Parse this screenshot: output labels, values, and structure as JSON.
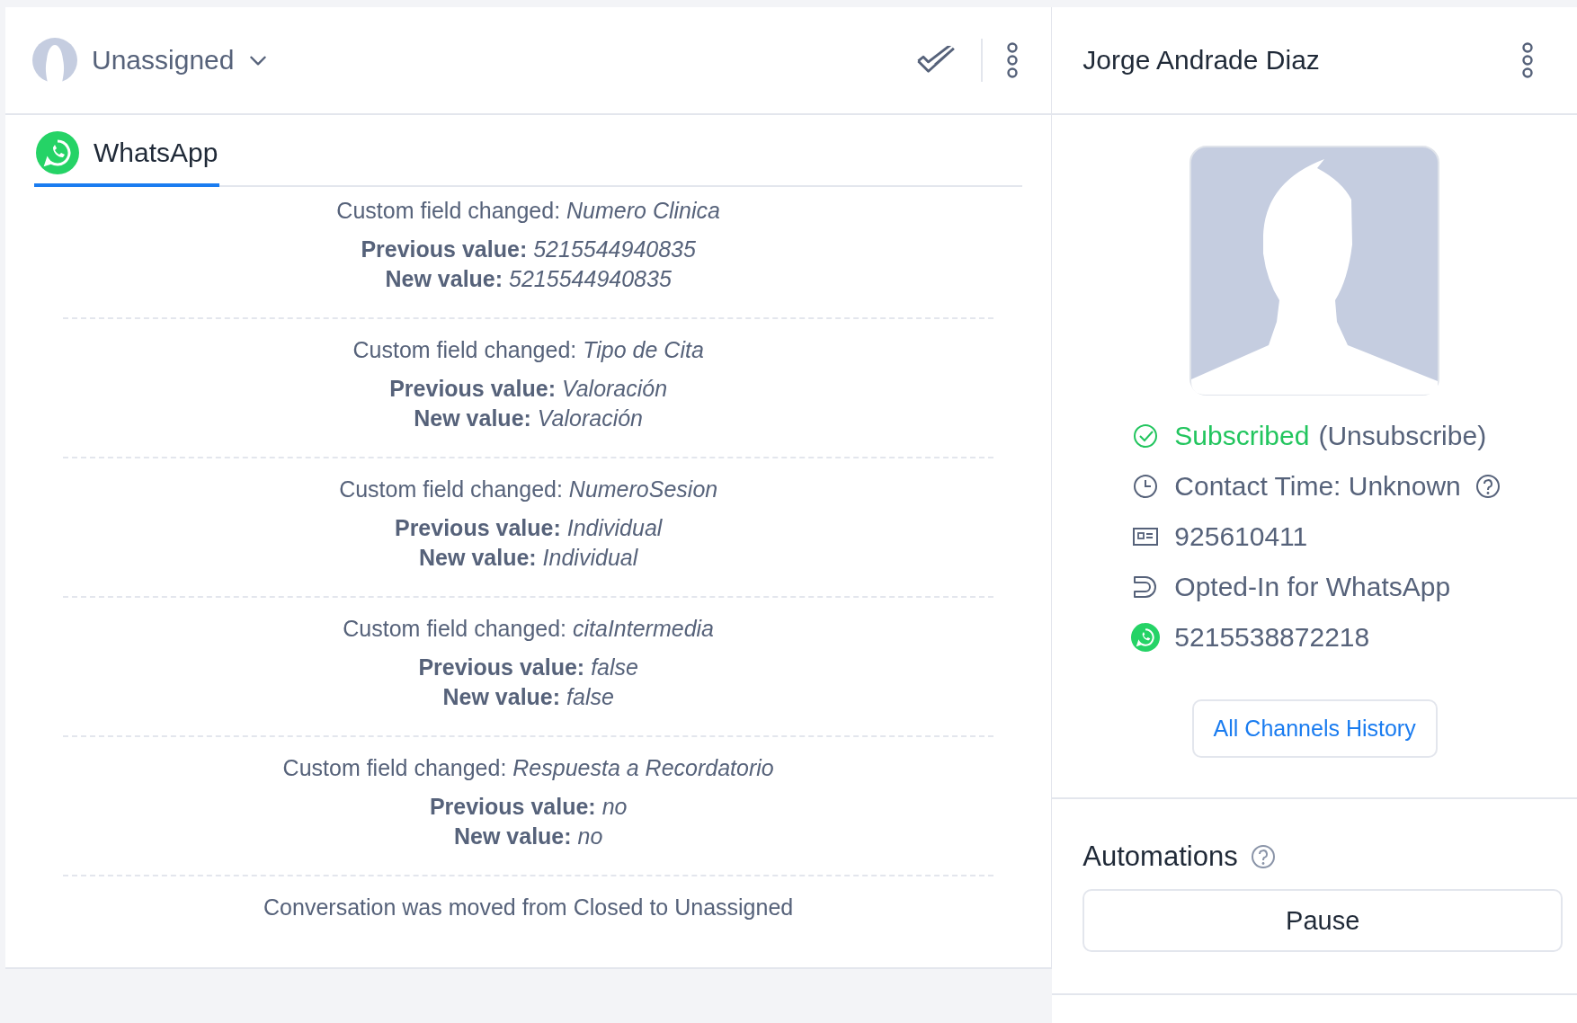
{
  "conversation": {
    "assignee": "Unassigned",
    "tabs": [
      {
        "label": "WhatsApp",
        "selected": true
      }
    ],
    "events": [
      {
        "kind": "field_change",
        "title": "Custom field changed: *Numero Clinica*",
        "previous": "**Previous value:** *5215544940835*",
        "new": "**New value:** *5215544940835*"
      },
      {
        "kind": "field_change",
        "title": "Custom field changed: *Tipo de Cita*",
        "previous": "**Previous value:** *Valoración*",
        "new": "**New value:** *Valoración*"
      },
      {
        "kind": "field_change",
        "title": "Custom field changed: *NumeroSesion*",
        "previous": "**Previous value:** *Individual*",
        "new": "**New value:** *Individual*"
      },
      {
        "kind": "field_change",
        "title": "Custom field changed: *citaIntermedia*",
        "previous": "**Previous value:** *false*",
        "new": "**New value:** *false*"
      },
      {
        "kind": "field_change",
        "title": "Custom field changed: *Respuesta a Recordatorio*",
        "previous": "**Previous value:** *no*",
        "new": "**New value:** *no*"
      },
      {
        "kind": "status",
        "text": "Conversation was moved from Closed to Unassigned"
      }
    ]
  },
  "contact": {
    "name": "Jorge Andrade Diaz",
    "details": [
      {
        "kind": "subscription",
        "text": "Subscribed",
        "action": "(Unsubscribe)"
      },
      {
        "kind": "contact_time",
        "text": "Contact Time: Unknown"
      },
      {
        "kind": "id",
        "text": "925610411"
      },
      {
        "kind": "opt_in",
        "text": "Opted-In for WhatsApp"
      },
      {
        "kind": "whatsapp",
        "text": "5215538872218"
      }
    ],
    "history_button": "All Channels History",
    "automations": {
      "title": "Automations",
      "button": "Pause"
    }
  }
}
